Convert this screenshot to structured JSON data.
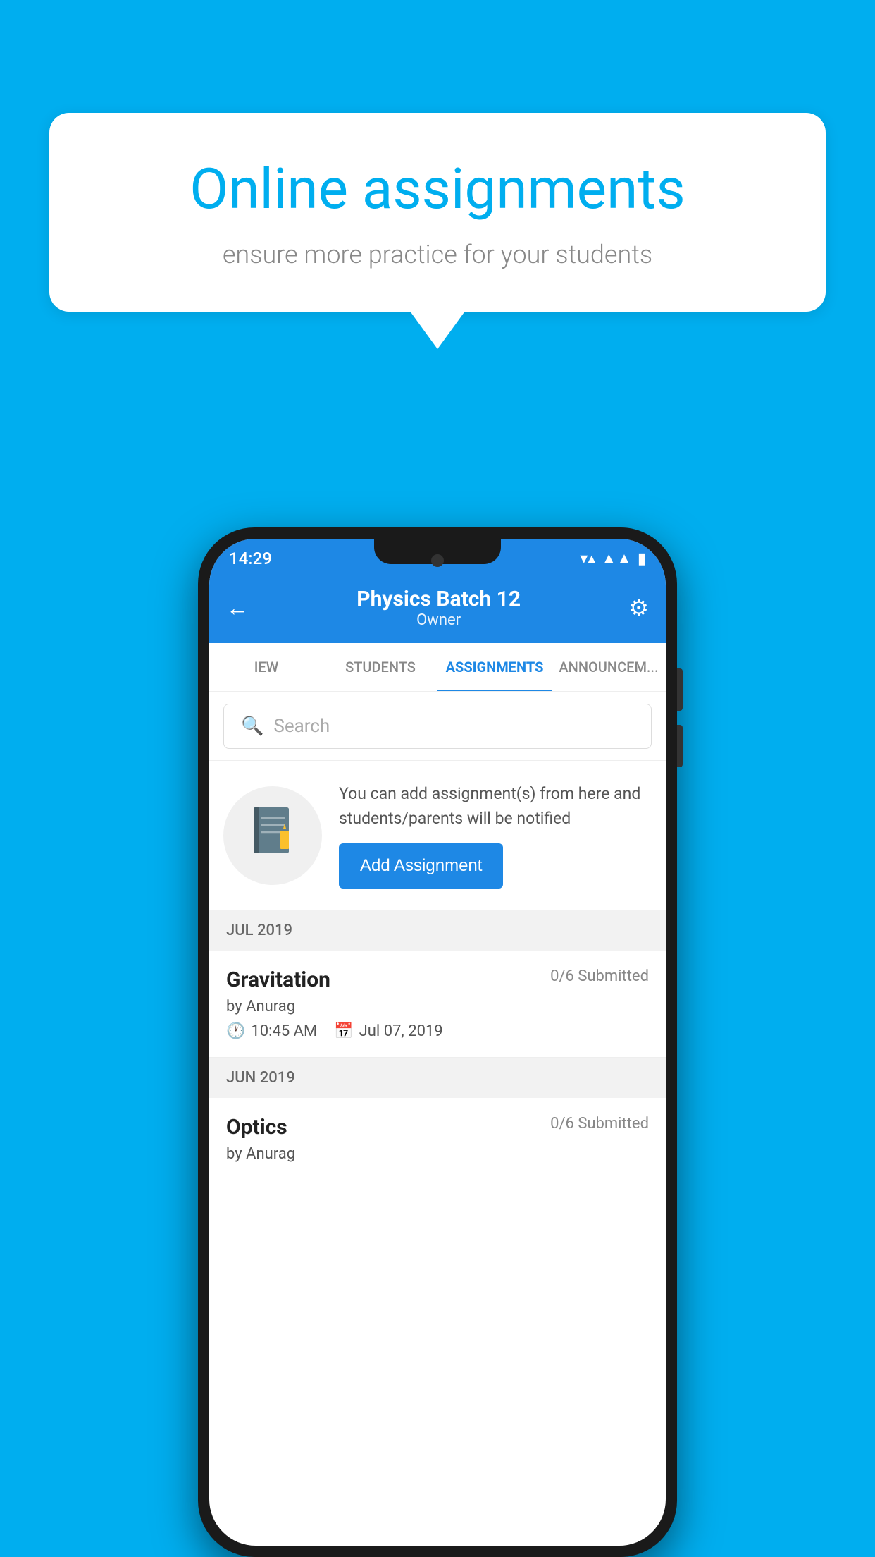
{
  "background_color": "#00AEEF",
  "speech_bubble": {
    "title": "Online assignments",
    "subtitle": "ensure more practice for your students"
  },
  "status_bar": {
    "time": "14:29",
    "wifi": "▼",
    "signal": "◀",
    "battery": "▮"
  },
  "header": {
    "title": "Physics Batch 12",
    "subtitle": "Owner",
    "back_icon": "←",
    "settings_icon": "⚙"
  },
  "tabs": [
    {
      "label": "IEW",
      "active": false
    },
    {
      "label": "STUDENTS",
      "active": false
    },
    {
      "label": "ASSIGNMENTS",
      "active": true
    },
    {
      "label": "ANNOUNCEM...",
      "active": false
    }
  ],
  "search": {
    "placeholder": "Search"
  },
  "prompt": {
    "icon": "📒",
    "text": "You can add assignment(s) from here and students/parents will be notified",
    "button_label": "Add Assignment"
  },
  "sections": [
    {
      "label": "JUL 2019",
      "assignments": [
        {
          "name": "Gravitation",
          "submitted": "0/6 Submitted",
          "by": "by Anurag",
          "time": "10:45 AM",
          "date": "Jul 07, 2019"
        }
      ]
    },
    {
      "label": "JUN 2019",
      "assignments": [
        {
          "name": "Optics",
          "submitted": "0/6 Submitted",
          "by": "by Anurag",
          "time": "",
          "date": ""
        }
      ]
    }
  ]
}
